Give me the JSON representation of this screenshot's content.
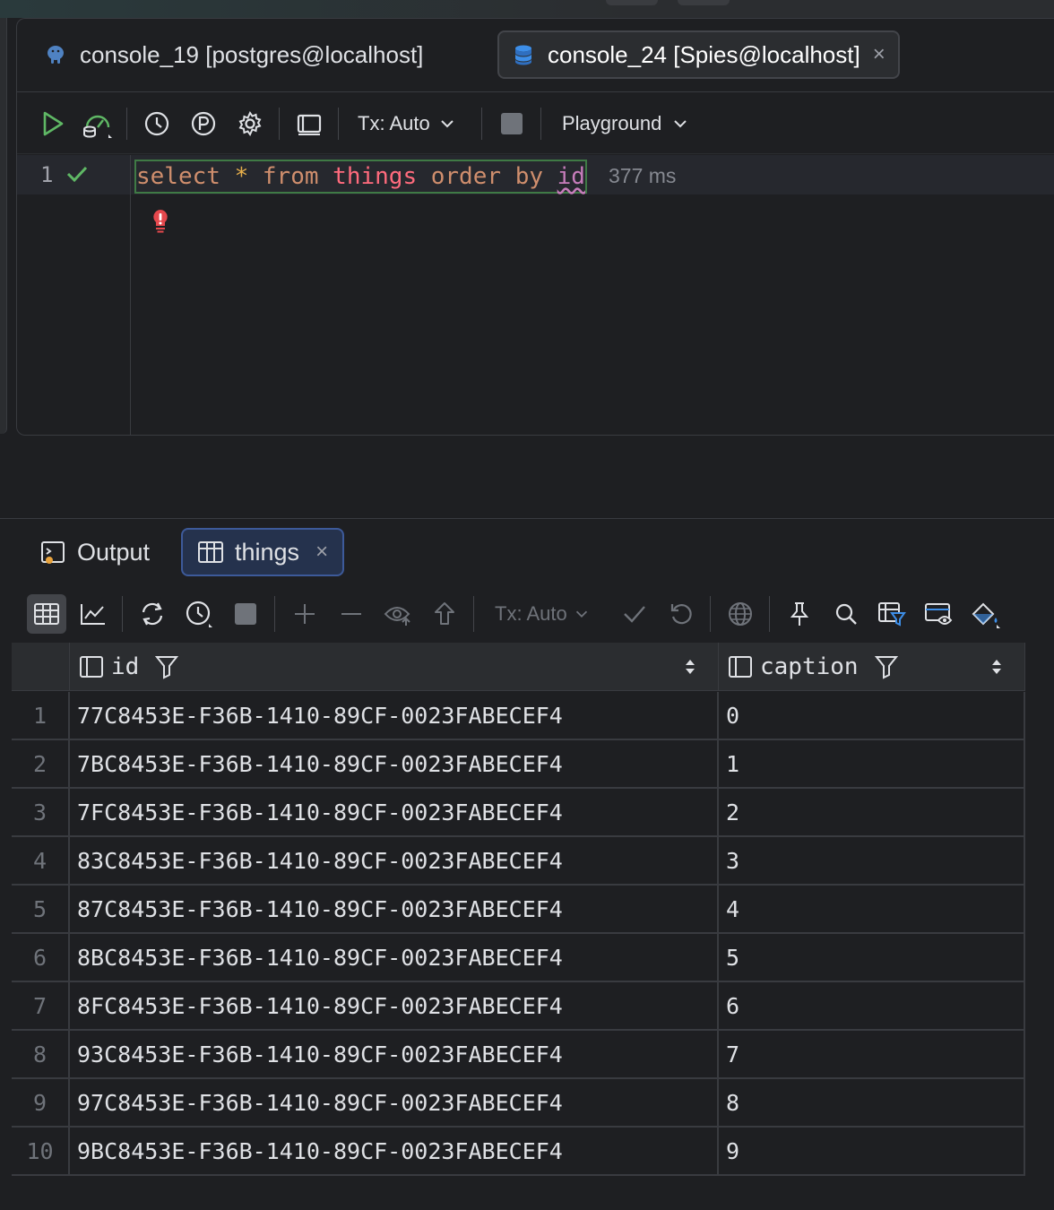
{
  "editor": {
    "tabs": [
      {
        "label": "console_19 [postgres@localhost]",
        "icon": "postgres-elephant-icon",
        "active": false
      },
      {
        "label": "console_24 [Spies@localhost]",
        "icon": "database-stack-icon",
        "active": true,
        "close": "×"
      }
    ],
    "toolbar": {
      "tx_label": "Tx: Auto",
      "schema_label": "Playground"
    },
    "code": {
      "line_number": "1",
      "tokens": {
        "kw1": "select",
        "star": "*",
        "kw2": "from",
        "table": "things",
        "kw3": "order",
        "kw4": "by",
        "col": "id"
      },
      "timing": "377 ms"
    }
  },
  "results": {
    "tabs": [
      {
        "label": "Output",
        "active": false
      },
      {
        "label": "things",
        "active": true,
        "close": "×"
      }
    ],
    "toolbar": {
      "tx_label": "Tx: Auto"
    },
    "columns": [
      {
        "label": "id"
      },
      {
        "label": "caption"
      }
    ],
    "rows": [
      {
        "n": "1",
        "id": "77C8453E-F36B-1410-89CF-0023FABECEF4",
        "caption": "0"
      },
      {
        "n": "2",
        "id": "7BC8453E-F36B-1410-89CF-0023FABECEF4",
        "caption": "1"
      },
      {
        "n": "3",
        "id": "7FC8453E-F36B-1410-89CF-0023FABECEF4",
        "caption": "2"
      },
      {
        "n": "4",
        "id": "83C8453E-F36B-1410-89CF-0023FABECEF4",
        "caption": "3"
      },
      {
        "n": "5",
        "id": "87C8453E-F36B-1410-89CF-0023FABECEF4",
        "caption": "4"
      },
      {
        "n": "6",
        "id": "8BC8453E-F36B-1410-89CF-0023FABECEF4",
        "caption": "5"
      },
      {
        "n": "7",
        "id": "8FC8453E-F36B-1410-89CF-0023FABECEF4",
        "caption": "6"
      },
      {
        "n": "8",
        "id": "93C8453E-F36B-1410-89CF-0023FABECEF4",
        "caption": "7"
      },
      {
        "n": "9",
        "id": "97C8453E-F36B-1410-89CF-0023FABECEF4",
        "caption": "8"
      },
      {
        "n": "10",
        "id": "9BC8453E-F36B-1410-89CF-0023FABECEF4",
        "caption": "9"
      }
    ]
  },
  "colors": {
    "background": "#1e1f22",
    "keyword": "#cf8e6d",
    "table": "#ff6b7d",
    "success": "#5fb865",
    "active_tab_accent": "#3d5a9a"
  }
}
